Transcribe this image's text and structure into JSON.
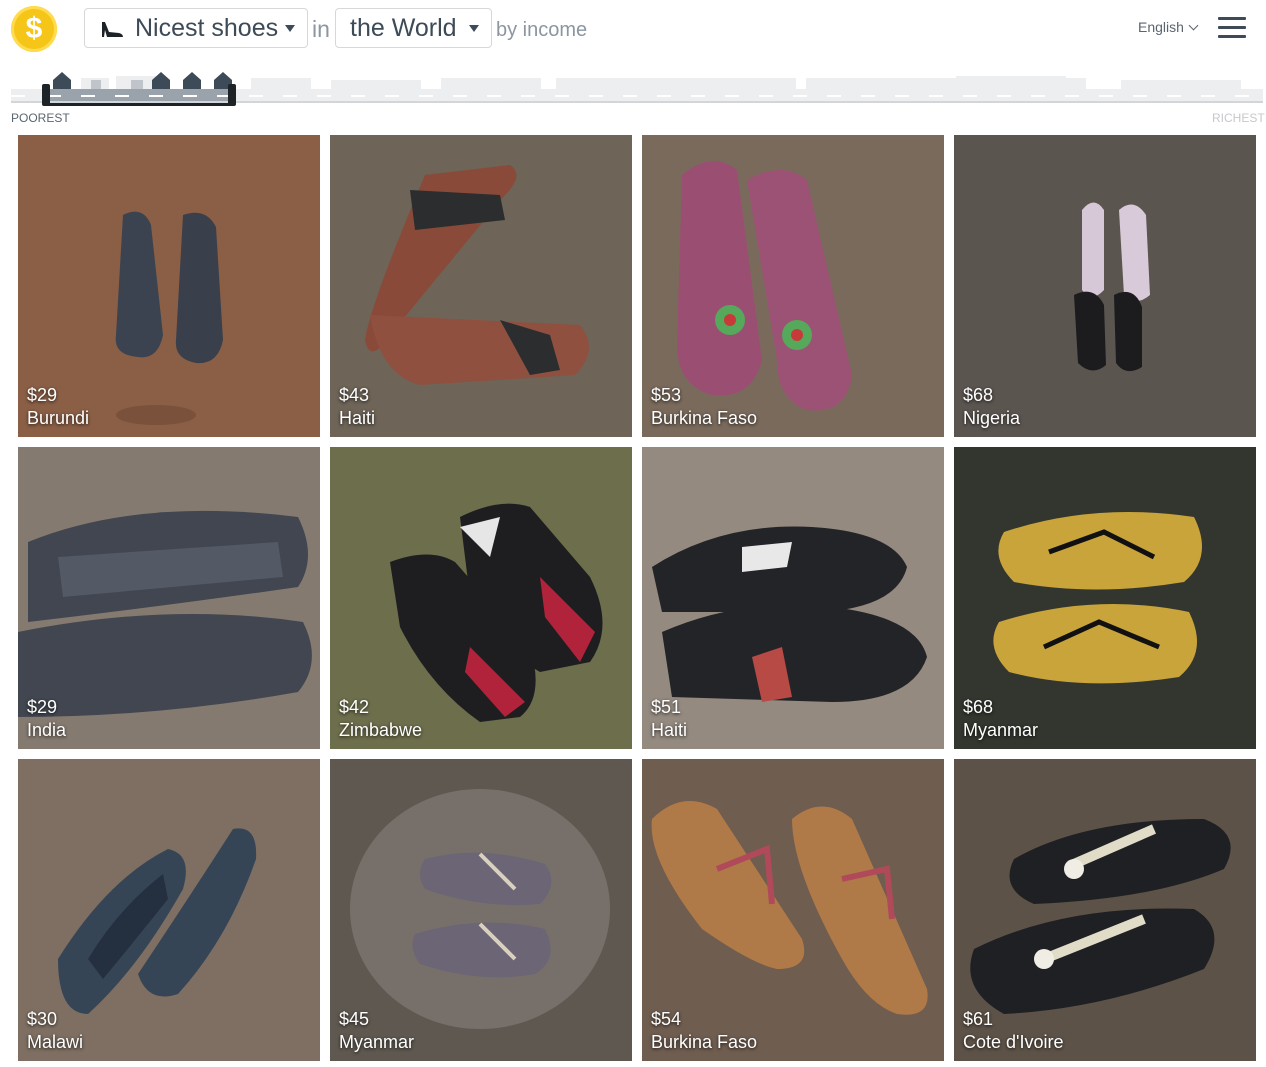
{
  "header": {
    "logo_symbol": "$",
    "thing_select": {
      "value": "Nicest shoes",
      "icon": "shoe-icon"
    },
    "connector_in": "in",
    "place_select": {
      "value": "the World"
    },
    "connector_by": "by income",
    "language": "English"
  },
  "income_scale": {
    "poorest_label": "POOREST",
    "richest_label": "RICHEST"
  },
  "colors": {
    "logo": "#f5c518",
    "text_dark": "#3d4a57",
    "strip_selected": "#9aa3ab",
    "handle": "#1e2328"
  },
  "cards": [
    {
      "income": "$29",
      "country": "Burundi"
    },
    {
      "income": "$43",
      "country": "Haiti"
    },
    {
      "income": "$53",
      "country": "Burkina Faso"
    },
    {
      "income": "$68",
      "country": "Nigeria"
    },
    {
      "income": "$29",
      "country": "India"
    },
    {
      "income": "$42",
      "country": "Zimbabwe"
    },
    {
      "income": "$51",
      "country": "Haiti"
    },
    {
      "income": "$68",
      "country": "Myanmar"
    },
    {
      "income": "$30",
      "country": "Malawi"
    },
    {
      "income": "$45",
      "country": "Myanmar"
    },
    {
      "income": "$54",
      "country": "Burkina Faso"
    },
    {
      "income": "$61",
      "country": "Cote d'Ivoire"
    }
  ]
}
